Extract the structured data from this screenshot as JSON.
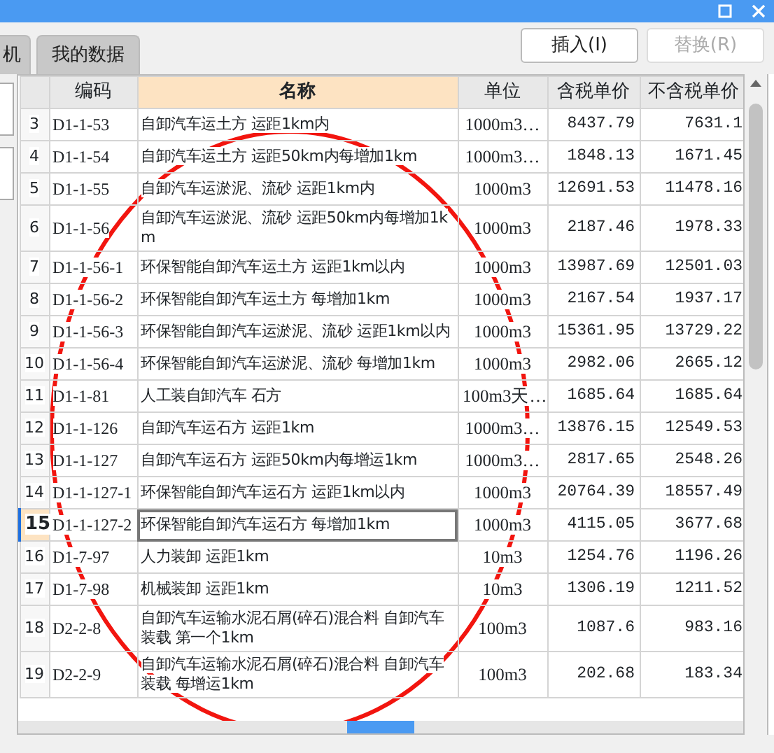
{
  "tabs": [
    {
      "label": "机",
      "selected": false
    },
    {
      "label": "我的数据",
      "selected": false
    }
  ],
  "buttons": [
    {
      "label": "插入(I)",
      "disabled": false
    },
    {
      "label": "替换(R)",
      "disabled": true
    }
  ],
  "table": {
    "columns": [
      {
        "selected": false
      },
      {
        "label": "编码",
        "selected": false
      },
      {
        "label": "名称",
        "selected": true
      },
      {
        "label": "单位",
        "selected": false
      },
      {
        "label": "含税单价",
        "selected": false
      },
      {
        "label": "不含税单价",
        "selected": false
      }
    ],
    "rows": [
      {
        "num": "3",
        "code": "D1-1-53",
        "name": "自卸汽车运土方 运距1km内",
        "unit": "1000m3…",
        "tax": "8437.79",
        "notax": "7631.1",
        "selected": false
      },
      {
        "num": "4",
        "code": "D1-1-54",
        "name": "自卸汽车运土方 运距50km内每增加1km",
        "unit": "1000m3…",
        "tax": "1848.13",
        "notax": "1671.45",
        "selected": false
      },
      {
        "num": "5",
        "code": "D1-1-55",
        "name": "自卸汽车运淤泥、流砂 运距1km内",
        "unit": "1000m3",
        "tax": "12691.53",
        "notax": "11478.16",
        "selected": false
      },
      {
        "num": "6",
        "code": "D1-1-56",
        "name": "自卸汽车运淤泥、流砂 运距50km内每增加1km",
        "unit": "1000m3",
        "tax": "2187.46",
        "notax": "1978.33",
        "selected": false
      },
      {
        "num": "7",
        "code": "D1-1-56-1",
        "name": "环保智能自卸汽车运土方 运距1km以内",
        "unit": "1000m3",
        "tax": "13987.69",
        "notax": "12501.03",
        "selected": false
      },
      {
        "num": "8",
        "code": "D1-1-56-2",
        "name": "环保智能自卸汽车运土方 每增加1km",
        "unit": "1000m3",
        "tax": "2167.54",
        "notax": "1937.17",
        "selected": false
      },
      {
        "num": "9",
        "code": "D1-1-56-3",
        "name": "环保智能自卸汽车运淤泥、流砂 运距1km以内",
        "unit": "1000m3",
        "tax": "15361.95",
        "notax": "13729.22",
        "selected": false
      },
      {
        "num": "10",
        "code": "D1-1-56-4",
        "name": "环保智能自卸汽车运淤泥、流砂 每增加1km",
        "unit": "1000m3",
        "tax": "2982.06",
        "notax": "2665.12",
        "selected": false
      },
      {
        "num": "11",
        "code": "D1-1-81",
        "name": "人工装自卸汽车 石方",
        "unit": "100m3天…",
        "tax": "1685.64",
        "notax": "1685.64",
        "selected": false
      },
      {
        "num": "12",
        "code": "D1-1-126",
        "name": "自卸汽车运石方 运距1km",
        "unit": "1000m3…",
        "tax": "13876.15",
        "notax": "12549.53",
        "selected": false
      },
      {
        "num": "13",
        "code": "D1-1-127",
        "name": "自卸汽车运石方 运距50km内每增运1km",
        "unit": "1000m3…",
        "tax": "2817.65",
        "notax": "2548.26",
        "selected": false
      },
      {
        "num": "14",
        "code": "D1-1-127-1",
        "name": "环保智能自卸汽车运石方 运距1km以内",
        "unit": "1000m3",
        "tax": "20764.39",
        "notax": "18557.49",
        "selected": false
      },
      {
        "num": "15",
        "code": "D1-1-127-2",
        "name": "环保智能自卸汽车运石方 每增加1km",
        "unit": "1000m3",
        "tax": "4115.05",
        "notax": "3677.68",
        "selected": true
      },
      {
        "num": "16",
        "code": "D1-7-97",
        "name": "人力装卸 运距1km",
        "unit": "10m3",
        "tax": "1254.76",
        "notax": "1196.26",
        "selected": false
      },
      {
        "num": "17",
        "code": "D1-7-98",
        "name": "机械装卸 运距1km",
        "unit": "10m3",
        "tax": "1306.19",
        "notax": "1211.52",
        "selected": false
      },
      {
        "num": "18",
        "code": "D2-2-8",
        "name": "自卸汽车运输水泥石屑(碎石)混合料 自卸汽车装载 第一个1km",
        "unit": "100m3",
        "tax": "1087.6",
        "notax": "983.16",
        "selected": false
      },
      {
        "num": "19",
        "code": "D2-2-9",
        "name": "自卸汽车运输水泥石屑(碎石)混合料 自卸汽车装载 每增运1km",
        "unit": "100m3",
        "tax": "202.68",
        "notax": "183.34",
        "selected": false
      }
    ]
  },
  "annotation": {
    "kind": "ellipse"
  }
}
